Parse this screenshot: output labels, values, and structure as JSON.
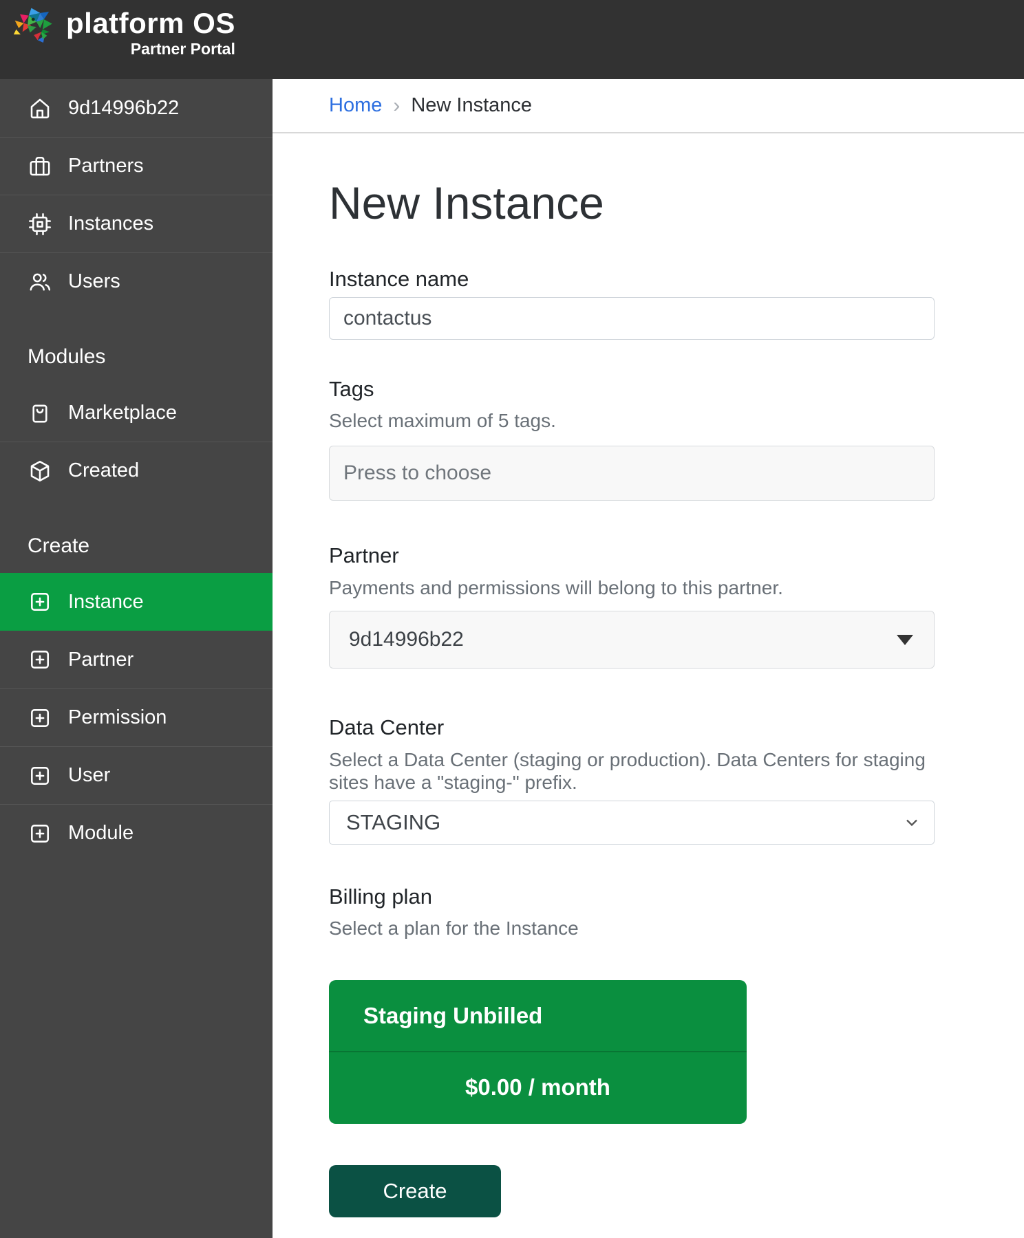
{
  "header": {
    "logo_title": "platform OS",
    "logo_subtitle": "Partner Portal"
  },
  "sidebar": {
    "sections": [
      {
        "header": "",
        "items": [
          {
            "label": "9d14996b22",
            "icon": "home-icon",
            "active": false
          },
          {
            "label": "Partners",
            "icon": "briefcase-icon",
            "active": false
          },
          {
            "label": "Instances",
            "icon": "chip-icon",
            "active": false
          },
          {
            "label": "Users",
            "icon": "users-icon",
            "active": false
          }
        ]
      },
      {
        "header": "Modules",
        "items": [
          {
            "label": "Marketplace",
            "icon": "shopping-bag-icon",
            "active": false
          },
          {
            "label": "Created",
            "icon": "cube-icon",
            "active": false
          }
        ]
      },
      {
        "header": "Create",
        "items": [
          {
            "label": "Instance",
            "icon": "plus-square-icon",
            "active": true
          },
          {
            "label": "Partner",
            "icon": "plus-square-icon",
            "active": false
          },
          {
            "label": "Permission",
            "icon": "plus-square-icon",
            "active": false
          },
          {
            "label": "User",
            "icon": "plus-square-icon",
            "active": false
          },
          {
            "label": "Module",
            "icon": "plus-square-icon",
            "active": false
          }
        ]
      }
    ]
  },
  "breadcrumb": {
    "home": "Home",
    "separator": "›",
    "current": "New Instance"
  },
  "page": {
    "title": "New Instance"
  },
  "form": {
    "instance_name": {
      "label": "Instance name",
      "value": "contactus"
    },
    "tags": {
      "label": "Tags",
      "help": "Select maximum of 5 tags.",
      "placeholder": "Press to choose"
    },
    "partner": {
      "label": "Partner",
      "help": "Payments and permissions will belong to this partner.",
      "value": "9d14996b22"
    },
    "data_center": {
      "label": "Data Center",
      "help": "Select a Data Center (staging or production). Data Centers for staging sites have a \"staging-\" prefix.",
      "value": "STAGING"
    },
    "billing_plan": {
      "label": "Billing plan",
      "help": "Select a plan for the Instance",
      "plan_name": "Staging Unbilled",
      "plan_price": "$0.00 / month"
    },
    "submit_label": "Create"
  },
  "colors": {
    "header_bg": "#323232",
    "sidebar_bg": "#454545",
    "active_green": "#0a9e43",
    "card_green": "#0a8f3f",
    "button_green": "#0b5144",
    "link_blue": "#2d6fe0"
  }
}
